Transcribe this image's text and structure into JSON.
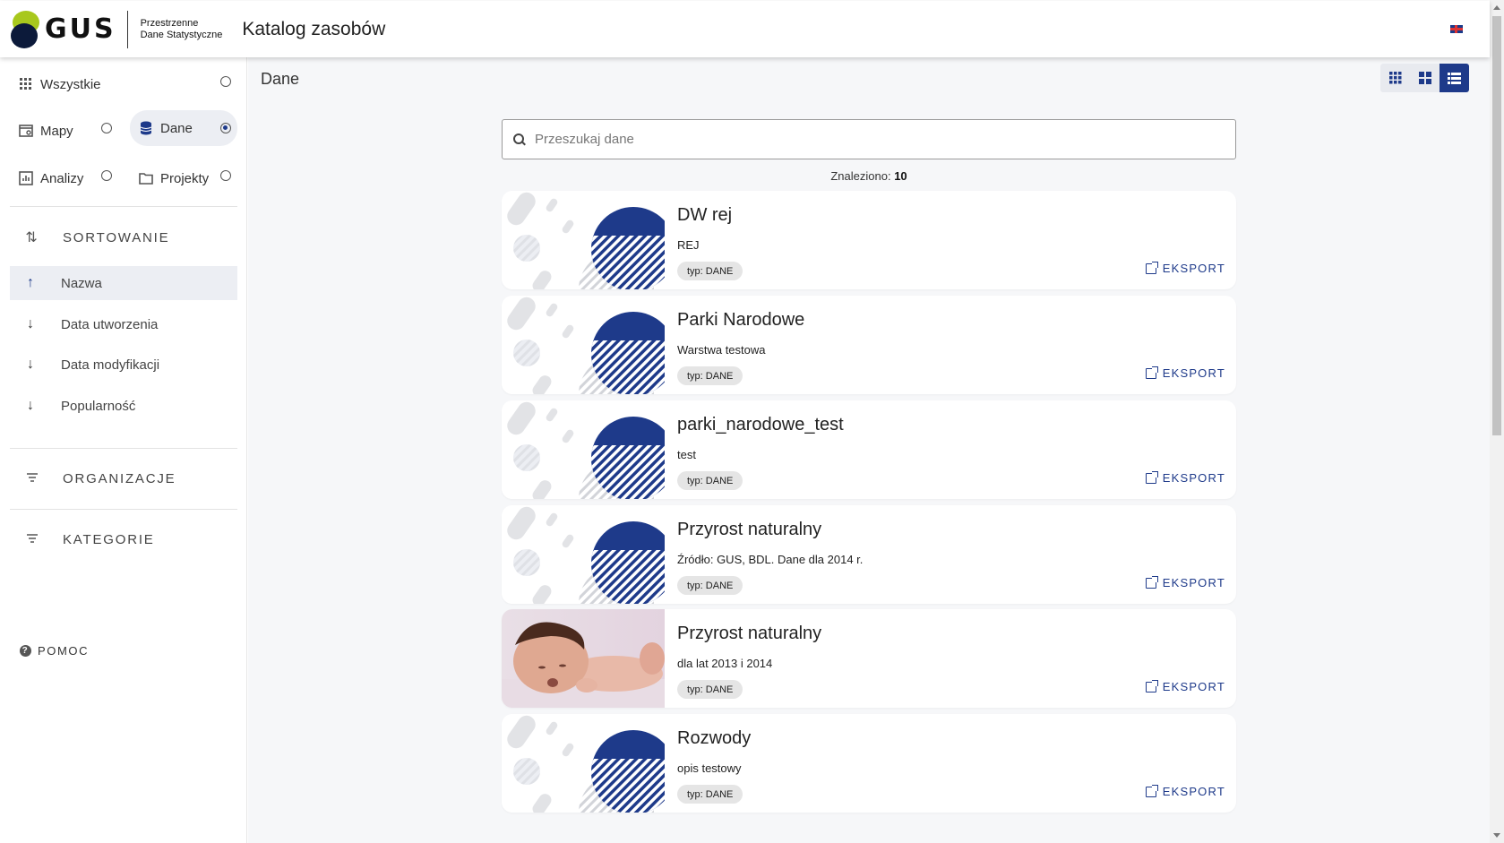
{
  "header": {
    "logo_text": "GUS",
    "logo_sub_line1": "Przestrzenne",
    "logo_sub_line2": "Dane Statystyczne",
    "app_title": "Katalog zasobów",
    "language_flag": "uk-flag-icon"
  },
  "sidebar": {
    "types": [
      {
        "label": "Wszystkie",
        "icon": "grid-icon",
        "selected": false
      },
      {
        "label": "Mapy",
        "icon": "map-icon",
        "selected": false
      },
      {
        "label": "Dane",
        "icon": "database-icon",
        "selected": true
      },
      {
        "label": "Analizy",
        "icon": "chart-icon",
        "selected": false
      },
      {
        "label": "Projekty",
        "icon": "folder-icon",
        "selected": false
      }
    ],
    "sorting": {
      "heading": "SORTOWANIE",
      "items": [
        {
          "label": "Nazwa",
          "direction": "up",
          "active": true
        },
        {
          "label": "Data utworzenia",
          "direction": "down",
          "active": false
        },
        {
          "label": "Data modyfikacji",
          "direction": "down",
          "active": false
        },
        {
          "label": "Popularność",
          "direction": "down",
          "active": false
        }
      ]
    },
    "organizations_heading": "ORGANIZACJE",
    "categories_heading": "KATEGORIE",
    "help_label": "POMOC"
  },
  "main": {
    "title": "Dane",
    "view_modes": [
      "small-grid-icon",
      "large-grid-icon",
      "list-icon"
    ],
    "active_view": "list-icon",
    "search": {
      "placeholder": "Przeszukaj dane",
      "value": ""
    },
    "found_label": "Znaleziono:",
    "found_count": "10",
    "cards": [
      {
        "title": "DW rej",
        "description": "REJ",
        "chip": "typ: DANE",
        "export_label": "EKSPORT",
        "thumbnail": "pattern"
      },
      {
        "title": "Parki Narodowe",
        "description": "Warstwa testowa",
        "chip": "typ: DANE",
        "export_label": "EKSPORT",
        "thumbnail": "pattern"
      },
      {
        "title": "parki_narodowe_test",
        "description": "test",
        "chip": "typ: DANE",
        "export_label": "EKSPORT",
        "thumbnail": "pattern"
      },
      {
        "title": "Przyrost naturalny",
        "description": "Źródło: GUS, BDL. Dane dla 2014 r.",
        "chip": "typ: DANE",
        "export_label": "EKSPORT",
        "thumbnail": "pattern"
      },
      {
        "title": "Przyrost naturalny",
        "description": "dla lat 2013 i 2014",
        "chip": "typ: DANE",
        "export_label": "EKSPORT",
        "thumbnail": "baby-photo"
      },
      {
        "title": "Rozwody",
        "description": "opis testowy",
        "chip": "typ: DANE",
        "export_label": "EKSPORT",
        "thumbnail": "pattern"
      }
    ]
  },
  "colors": {
    "accent": "#1e3a8a",
    "logo_green": "#a8c81d",
    "logo_navy": "#0c1a3a",
    "background": "#f6f7f9"
  }
}
